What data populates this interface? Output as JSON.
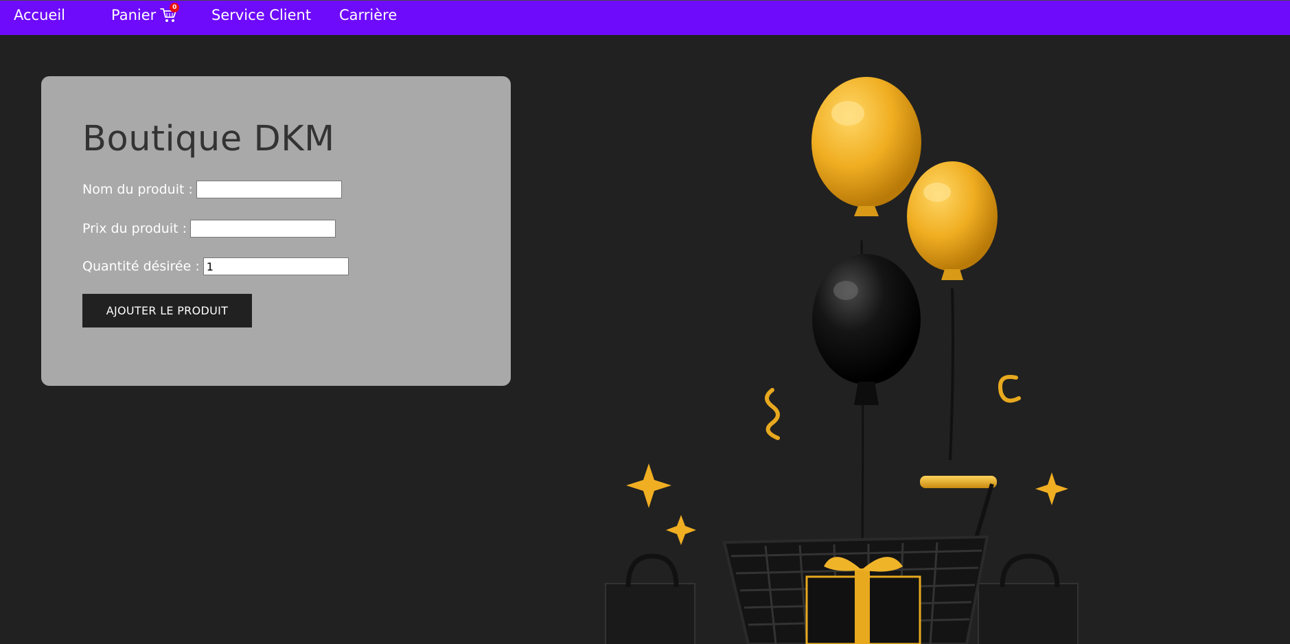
{
  "nav": {
    "home": "Accueil",
    "cart": "Panier",
    "cart_count": "0",
    "service": "Service Client",
    "careers": "Carrière"
  },
  "form": {
    "title": "Boutique DKM",
    "name_label": "Nom du produit :",
    "name_value": "",
    "price_label": "Prix du produit :",
    "price_value": "",
    "qty_label": "Quantité désirée :",
    "qty_value": "1",
    "submit_label": "AJOUTER LE PRODUIT"
  },
  "colors": {
    "navbar": "#6e0bfb",
    "background": "#212121",
    "card": "#a9a9a9",
    "badge": "#e80e0e",
    "balloon_gold": "#f0b429",
    "balloon_black": "#1a1a1a"
  },
  "icons": {
    "cart": "shopping-cart-icon"
  }
}
